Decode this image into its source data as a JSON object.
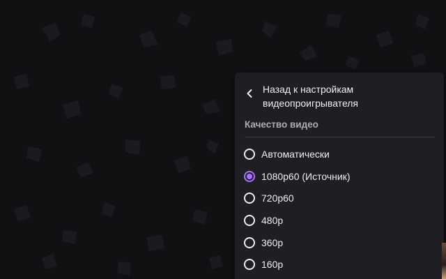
{
  "quality_menu": {
    "back_label": "Назад к настройкам видеопроигрывателя",
    "back_icon": "chevron-left-icon",
    "section_title": "Качество видео",
    "accent_color": "#a970ff",
    "background_color": "#1f1f23",
    "selected_index": 1,
    "options": [
      {
        "label": "Автоматически",
        "checked": false
      },
      {
        "label": "1080p60 (Источник)",
        "checked": true
      },
      {
        "label": "720p60",
        "checked": false
      },
      {
        "label": "480p",
        "checked": false
      },
      {
        "label": "360p",
        "checked": false
      },
      {
        "label": "160p",
        "checked": false
      }
    ]
  }
}
